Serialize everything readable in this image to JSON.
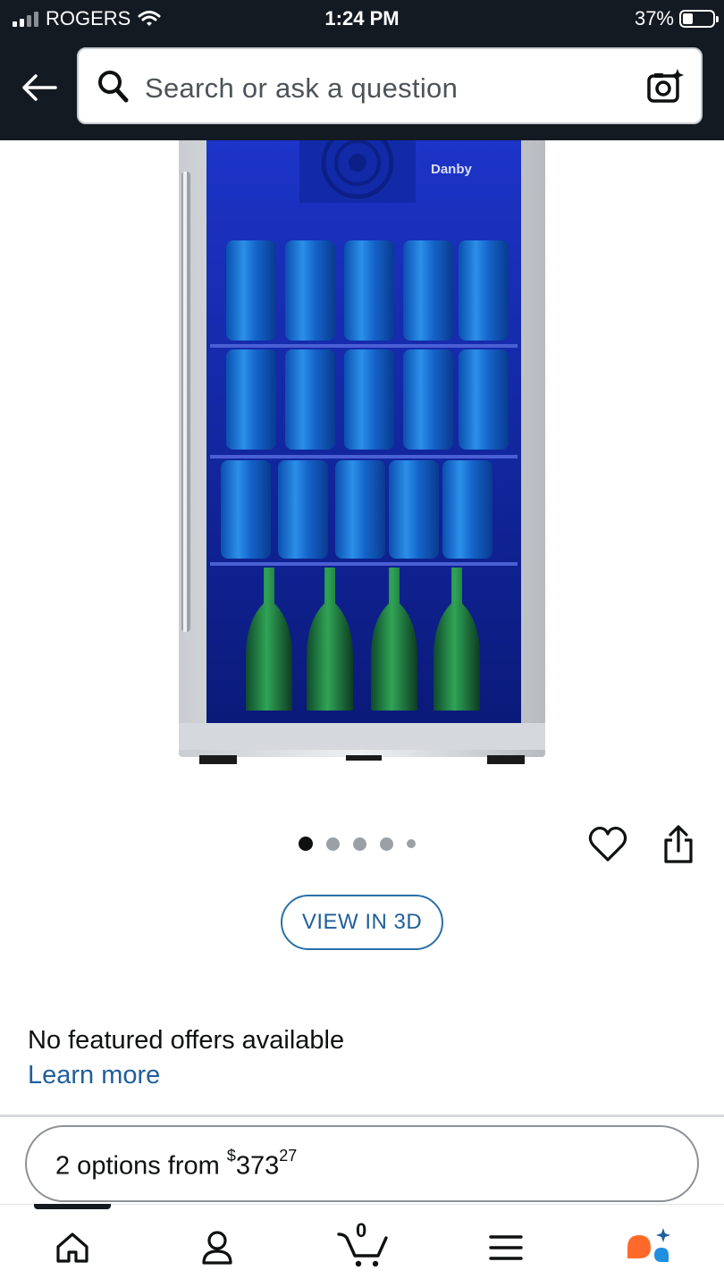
{
  "status_bar": {
    "carrier": "ROGERS",
    "time": "1:24 PM",
    "battery": "37%"
  },
  "header": {
    "search_placeholder": "Search or ask a question",
    "icons": [
      "back-arrow-icon",
      "search-icon",
      "camera-search-icon"
    ]
  },
  "product_image": {
    "brand_label": "Danby",
    "carousel": {
      "total": 5,
      "active_index": 0
    }
  },
  "actions": {
    "wishlist_icon": "heart-icon",
    "share_icon": "share-icon",
    "view_3d_label": "VIEW IN 3D"
  },
  "offers": {
    "status_text": "No featured offers available",
    "learn_more_label": "Learn more"
  },
  "buying_options": {
    "prefix": "2 options from ",
    "currency": "$",
    "price_whole": "373",
    "price_fraction": "27"
  },
  "bottom_nav": {
    "items": [
      "home-icon",
      "account-icon",
      "cart-icon",
      "menu-icon",
      "rufus-assistant-icon"
    ],
    "cart_count": "0"
  },
  "colors": {
    "header_bg": "#131a22",
    "link_blue": "#1f5f9a",
    "fridge_interior": "#1a3bb5",
    "assistant_orange": "#ff6a2a",
    "assistant_blue": "#1f8fe0"
  }
}
